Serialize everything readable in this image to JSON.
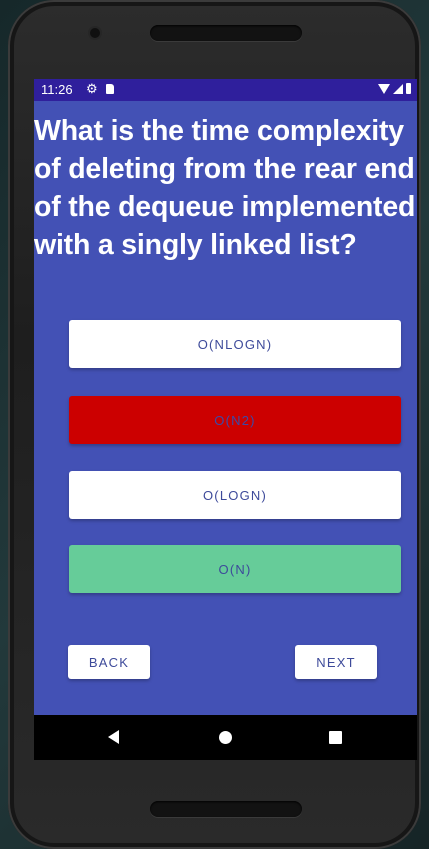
{
  "status_bar": {
    "time": "11:26",
    "icons": [
      "gear-icon",
      "sd-card-icon",
      "wifi-icon",
      "signal-icon",
      "battery-icon"
    ]
  },
  "question": {
    "text": "What is the time complexity of deleting from the rear end of the dequeue implemented with a singly linked list?"
  },
  "options": [
    {
      "label": "O(NLOGN)",
      "color": "#ffffff"
    },
    {
      "label": "O(N2)",
      "color": "#cc0000",
      "state": "wrong"
    },
    {
      "label": "O(LOGN)",
      "color": "#ffffff"
    },
    {
      "label": "O(N)",
      "color": "#66cc99",
      "state": "correct"
    }
  ],
  "navigation": {
    "back_label": "BACK",
    "next_label": "NEXT"
  },
  "system_nav": {
    "icons": [
      "back-triangle-icon",
      "home-circle-icon",
      "recents-square-icon"
    ]
  },
  "colors": {
    "screen_bg": "#4351b5",
    "status_bar": "#2f1f9c"
  }
}
